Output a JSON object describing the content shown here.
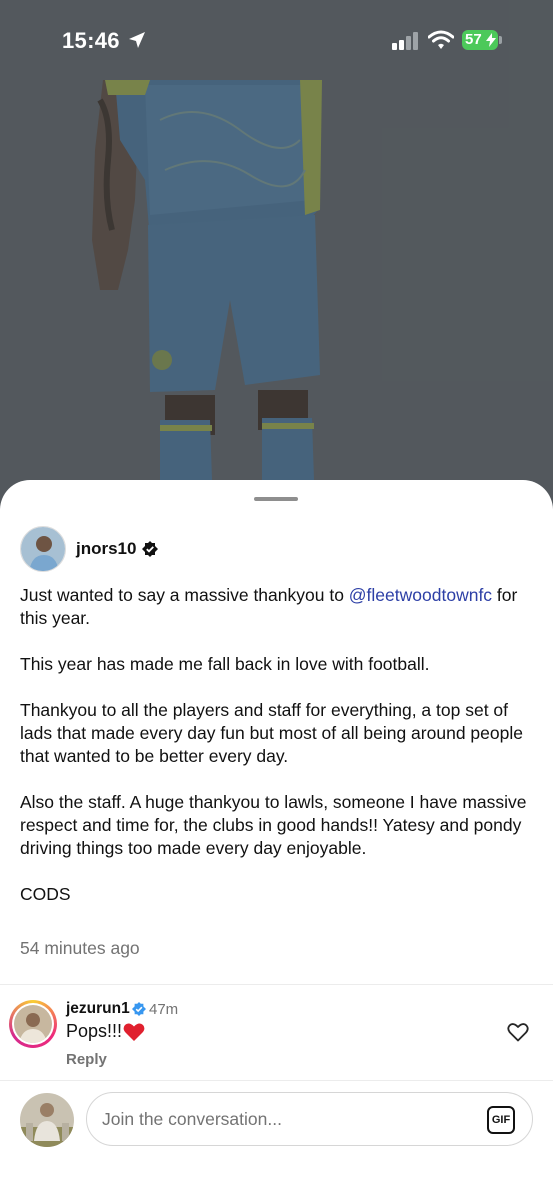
{
  "status_bar": {
    "time": "15:46",
    "battery": "57",
    "icons": [
      "location-arrow-icon",
      "signal-bars-icon",
      "wifi-icon",
      "battery-charging-icon"
    ]
  },
  "post": {
    "author": "jnors10",
    "caption_parts": {
      "p1_before": "Just wanted to say a massive thankyou to ",
      "p1_mention": "@fleetwoodtownfc",
      "p1_after": " for this year.",
      "p2": "This year has made me fall back in love with football.",
      "p3": "Thankyou to all the players and staff for everything, a top set of lads that made every day fun but most of all being around people that wanted to be better every day.",
      "p4": "Also the staff. A huge thankyou to lawls, someone I have massive respect and time for, the clubs in good hands!! Yatesy and pondy driving things too made every day enjoyable.",
      "p5": "CODS"
    },
    "timestamp": "54 minutes ago"
  },
  "comments": [
    {
      "user": "jezurun1",
      "time": "47m",
      "text": "Pops!!!",
      "reply_label": "Reply"
    }
  ],
  "composer": {
    "placeholder": "Join the conversation...",
    "gif_label": "GIF"
  },
  "colors": {
    "mention": "#2d3fa6",
    "secondary_text": "#737373",
    "battery": "#4cc95a",
    "verified": "#3897f0"
  }
}
